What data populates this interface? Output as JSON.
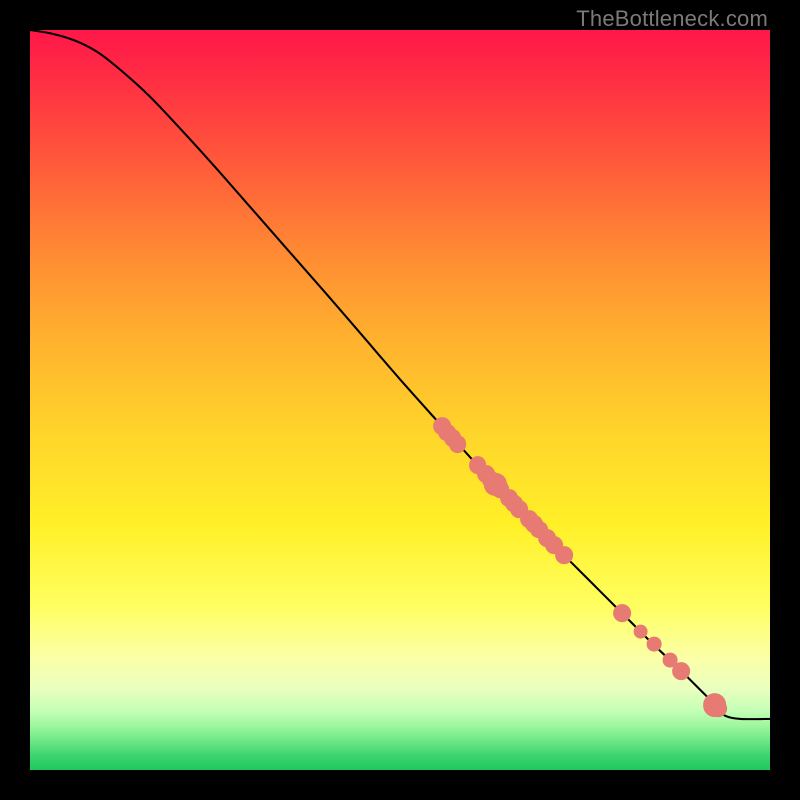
{
  "attribution": "TheBottleneck.com",
  "colors": {
    "page_bg": "#000000",
    "curve_stroke": "#000000",
    "dot_fill": "#e77a73",
    "attribution_text": "#7a7a7a"
  },
  "chart_data": {
    "type": "line",
    "title": "",
    "xlabel": "",
    "ylabel": "",
    "xlim": [
      0,
      100
    ],
    "ylim": [
      0,
      100
    ],
    "grid": false,
    "legend": false,
    "series": [
      {
        "name": "curve",
        "x": [
          0,
          3,
          6,
          9,
          12,
          16,
          20,
          25,
          30,
          35,
          40,
          45,
          50,
          55,
          58,
          60,
          62,
          64,
          65,
          66,
          68,
          70,
          72,
          74,
          76,
          78,
          80,
          82,
          84,
          86,
          88,
          89,
          90,
          91,
          91.5,
          92,
          92.5,
          93,
          94,
          96,
          100
        ],
        "y": [
          100,
          99.5,
          98.6,
          97.1,
          94.8,
          91.2,
          87.0,
          81.5,
          75.8,
          70.1,
          64.4,
          58.6,
          52.8,
          47.2,
          43.9,
          41.7,
          39.6,
          37.5,
          36.5,
          35.5,
          33.4,
          31.3,
          29.2,
          27.2,
          25.2,
          23.2,
          21.2,
          19.2,
          17.2,
          15.3,
          13.4,
          12.4,
          11.4,
          10.4,
          9.9,
          9.3,
          8.8,
          8.3,
          7.3,
          6.9,
          6.9
        ]
      }
    ],
    "points": [
      {
        "x": 55.7,
        "y": 46.5,
        "r": 1.2
      },
      {
        "x": 56.4,
        "y": 45.6,
        "r": 1.2
      },
      {
        "x": 57.1,
        "y": 44.8,
        "r": 1.2
      },
      {
        "x": 57.8,
        "y": 44.0,
        "r": 1.2
      },
      {
        "x": 60.5,
        "y": 41.2,
        "r": 1.2
      },
      {
        "x": 61.6,
        "y": 40.0,
        "r": 1.2
      },
      {
        "x": 62.3,
        "y": 39.2,
        "r": 1.2
      },
      {
        "x": 62.9,
        "y": 38.6,
        "r": 1.5
      },
      {
        "x": 63.5,
        "y": 38.0,
        "r": 1.2
      },
      {
        "x": 64.7,
        "y": 36.7,
        "r": 1.2
      },
      {
        "x": 65.4,
        "y": 36.0,
        "r": 1.2
      },
      {
        "x": 66.1,
        "y": 35.3,
        "r": 1.2
      },
      {
        "x": 67.4,
        "y": 33.9,
        "r": 1.2
      },
      {
        "x": 68.1,
        "y": 33.2,
        "r": 1.2
      },
      {
        "x": 68.8,
        "y": 32.5,
        "r": 1.2
      },
      {
        "x": 69.9,
        "y": 31.3,
        "r": 1.2
      },
      {
        "x": 70.8,
        "y": 30.4,
        "r": 1.2
      },
      {
        "x": 72.2,
        "y": 29.0,
        "r": 1.2
      },
      {
        "x": 80.0,
        "y": 21.2,
        "r": 1.2
      },
      {
        "x": 82.5,
        "y": 18.7,
        "r": 1.0
      },
      {
        "x": 84.3,
        "y": 17.0,
        "r": 1.0
      },
      {
        "x": 86.5,
        "y": 14.8,
        "r": 1.0
      },
      {
        "x": 88.0,
        "y": 13.4,
        "r": 1.2
      },
      {
        "x": 92.5,
        "y": 8.8,
        "r": 1.6
      },
      {
        "x": 93.0,
        "y": 8.3,
        "r": 1.2
      }
    ]
  }
}
